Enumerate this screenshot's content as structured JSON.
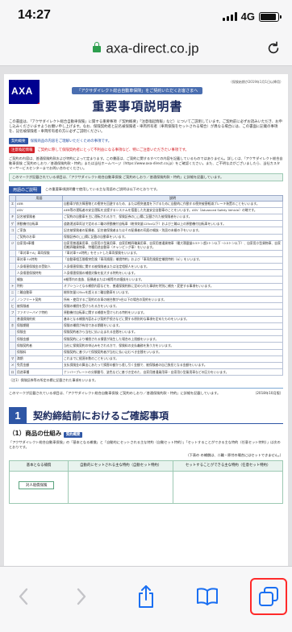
{
  "status": {
    "time": "14:27",
    "network": "4G"
  },
  "browser": {
    "url": "axa-direct.co.jp"
  },
  "doc": {
    "logo_text": "AXA",
    "subtitle": "「アクサダイレクト総合自動車保険」をご契約いただくお客さまへ",
    "title": "重要事項説明書",
    "revision": "（保険始期が2019年1月1日以降用）",
    "lead": "この書面は、「アクサダイレクト総合自動車保険」に関する重要事項（「契約概要」「注意喚起情報」など）についてご説明しています。ご契約前に必ずお読みいただき、お申し込みくださいますようお願い申し上げます。なお、保険契約者と記名被保険者・車両所有者（車両保険をセットされる場合）が異なる場合には、この書面に記載の事項を、記名被保険者・車両所有者の方に必ずご説明ください。",
    "legend": [
      {
        "tag": "契約概要",
        "text": "保険商品の内容をご理解いただくための事項です。",
        "color": "blue"
      },
      {
        "tag": "注意喚起情報",
        "text": "ご契約に際して保険契約者にとって不利益になる事項など、特にご注意いただきたい事項です。",
        "color": "red"
      }
    ],
    "para1": "ご契約の内容は、普通保険約款および特約によって定まります。この書面は、ご契約に関するすべての内容を記載しているものではありません。詳しくは、「アクサダイレクト総合自動車保険 ご契約のしおり／普通保険約款・特約」または当社ホームページ（https://www.axa-direct.co.jp）をご確認ください。また、ご不明な点がございましたら、当社カスタマーサービスセンターまでお問い合わせください。",
    "note_bar": "このマークが記載されている項目は、「アクサダイレクト総合自動車保険 ご契約のしおり／普通保険約款・特約」に詳細を記載しています。",
    "terms_label": "用語のご説明",
    "terms_note": "この重要事項説明書で使用している主な用語のご説明は以下のとおりです。",
    "terms_head": {
      "kana": "",
      "term": "用語",
      "desc": "説明"
    },
    "terms": [
      {
        "k": "エ",
        "t": "AEB",
        "d": "自動車が前方障害物との衝突を回避するため、または衝突速度を下げるために自動的に作動する衝突被害軽減ブレーキ装置のことをいいます。"
      },
      {
        "k": "",
        "t": "ASV",
        "d": "AEB等の運転者の安全運転を支援するシステムを搭載した先進安全自動車のことをいいます。ASV（Advanced Safety Vehicle）の略です。"
      },
      {
        "k": "キ",
        "t": "記名被保険者",
        "d": "ご契約の自動車を主に運転される方で、保険証券の□□欄に記載された被保険者をいいます。"
      },
      {
        "k": "ゲ",
        "t": "原動機付自転車",
        "d": "道路運送車両法で定める二輪の原動機付自転車（総排気量125cc以下）および三輪以上の原動機付自転車をいいます。"
      },
      {
        "k": "コ",
        "t": "ご家族",
        "d": "記名被保険者の配偶者、記名被保険者またはその配偶者の同居の親族・別居の未婚の子をいいます。"
      },
      {
        "k": "",
        "t": "ご契約のお車",
        "d": "保険証券の□□欄に記載の自動車をいいます。"
      },
      {
        "k": "ジ",
        "t": "自家用8車種",
        "d": "自家用普通乗用車、自家用小型乗用車、自家用軽四輪乗用車、自家用普通貨物車（最大積載量0.5トン超2トン以下・0.5トン以下）、自家用小型貨物車、自家用軽四輪貨物車、特種用途自動車（キャンピング車）をいいます。"
      },
      {
        "k": "",
        "t": "「車対車＋A」車両保険",
        "d": "「車対車＋A特約」をセットした車両保険をいいます。"
      },
      {
        "k": "",
        "t": "車対車＋A特約",
        "d": "「自動車相互間衝突危険『車両損害』補償特約」および「車両危険限定補償特約（A）」をいいます。"
      },
      {
        "k": "",
        "t": "人身傷害保険金の受取人",
        "d": "人身傷害保険に関する被保険者または法定相続人をいいます。"
      },
      {
        "k": "",
        "t": "人身傷害保険特約",
        "d": "人身傷害保険の補償対象を拡大する特約をいいます。"
      },
      {
        "k": "",
        "t": "親族",
        "d": "6親等内の血族、配偶者または3親等内の姻族をいいます。"
      },
      {
        "k": "ト",
        "t": "特約",
        "d": "オプションとなる補償内容などを、普通保険約款に定められた事項を特別に補充・変更する事項をいいます。"
      },
      {
        "k": "ニ",
        "t": "二輪自動車",
        "d": "総排気量125ccを超える二輪自動車をいいます。"
      },
      {
        "k": "ノ",
        "t": "ノンフリート契約",
        "d": "所有・使用するご契約のお車の総台数が9台以下の場合の契約をいいます。"
      },
      {
        "k": "ヒ",
        "t": "被保険者",
        "d": "保険の補償を受けられる方をいいます。"
      },
      {
        "k": "フ",
        "t": "ファミリーバイク特約",
        "d": "原動機付自転車に関する補償を受けられる特約をいいます。"
      },
      {
        "k": "",
        "t": "普通保険約款",
        "d": "基本となる補償内容および契約手続きなどに関する原則的な事項を定めたものをいいます。"
      },
      {
        "k": "ホ",
        "t": "保険期間",
        "d": "保険の補償が有効である期間をいいます。"
      },
      {
        "k": "",
        "t": "保険金",
        "d": "保険契約者から当社に払い込まれる金銭をいいます。"
      },
      {
        "k": "",
        "t": "保険金額",
        "d": "保険契約により補償される損害が発生した場合の上限額をいいます。"
      },
      {
        "k": "",
        "t": "保険契約者",
        "d": "当社に保険契約の申込みをされる方で、保険料の支払義務を負う方をいいます。"
      },
      {
        "k": "",
        "t": "保険料",
        "d": "保険契約に基づいて保険契約者が当社に払い込むべき金銭をいいます。"
      },
      {
        "k": "マ",
        "t": "満期",
        "d": "これまでに経過年数のことをいいます。"
      },
      {
        "k": "メ",
        "t": "免責金額",
        "d": "支払保険金の算出にあたって損害の額から差し引く金額で、被保険者の自己負担となる金額をいいます。"
      },
      {
        "k": "ロ",
        "t": "用途車種",
        "d": "ナンバープレートの分類番号、塗色などに基づき定めた、自家用普通乗用車・自家用小型乗用車などの区分をいいます。"
      }
    ],
    "footnote": "（注1）保険証券等の所定の欄に記載された事項をいいます。",
    "footer_note": "このマークが記載されている項目は、「アクサダイレクト総合自動車保険 ご契約のしおり／普通保険約款・特約」に詳細を記載しています。",
    "footer_date": "（2018年10月版）",
    "section": {
      "num": "1",
      "title": "契約締結前におけるご確認事項",
      "sub_prefix": "（1）商品の仕組み",
      "sub_tag": "契約概要",
      "sub_note": "「アクサダイレクト総合自動車保険」の「基本となる補償」と「自動的にセットされる主な特約（自動セット特約）」「セットすることができる主な特約（任意セット特約）」は次のとおりです。",
      "legend": "（下表の   の補償は、二輪・原付の場合にはセットできません。）",
      "table_headers": [
        "基本となる補償",
        "自動的にセットされる主な特約（自動セット特約）",
        "セットすることができる主な特約（任意セット特約）"
      ],
      "pill": "対人賠償保険"
    }
  },
  "toolbar": {
    "back": "back-arrow",
    "forward": "forward-arrow",
    "share": "share-icon",
    "bookmarks": "book-icon",
    "tabs": "tabs-icon",
    "highlight_color": "#ff2a2a"
  }
}
